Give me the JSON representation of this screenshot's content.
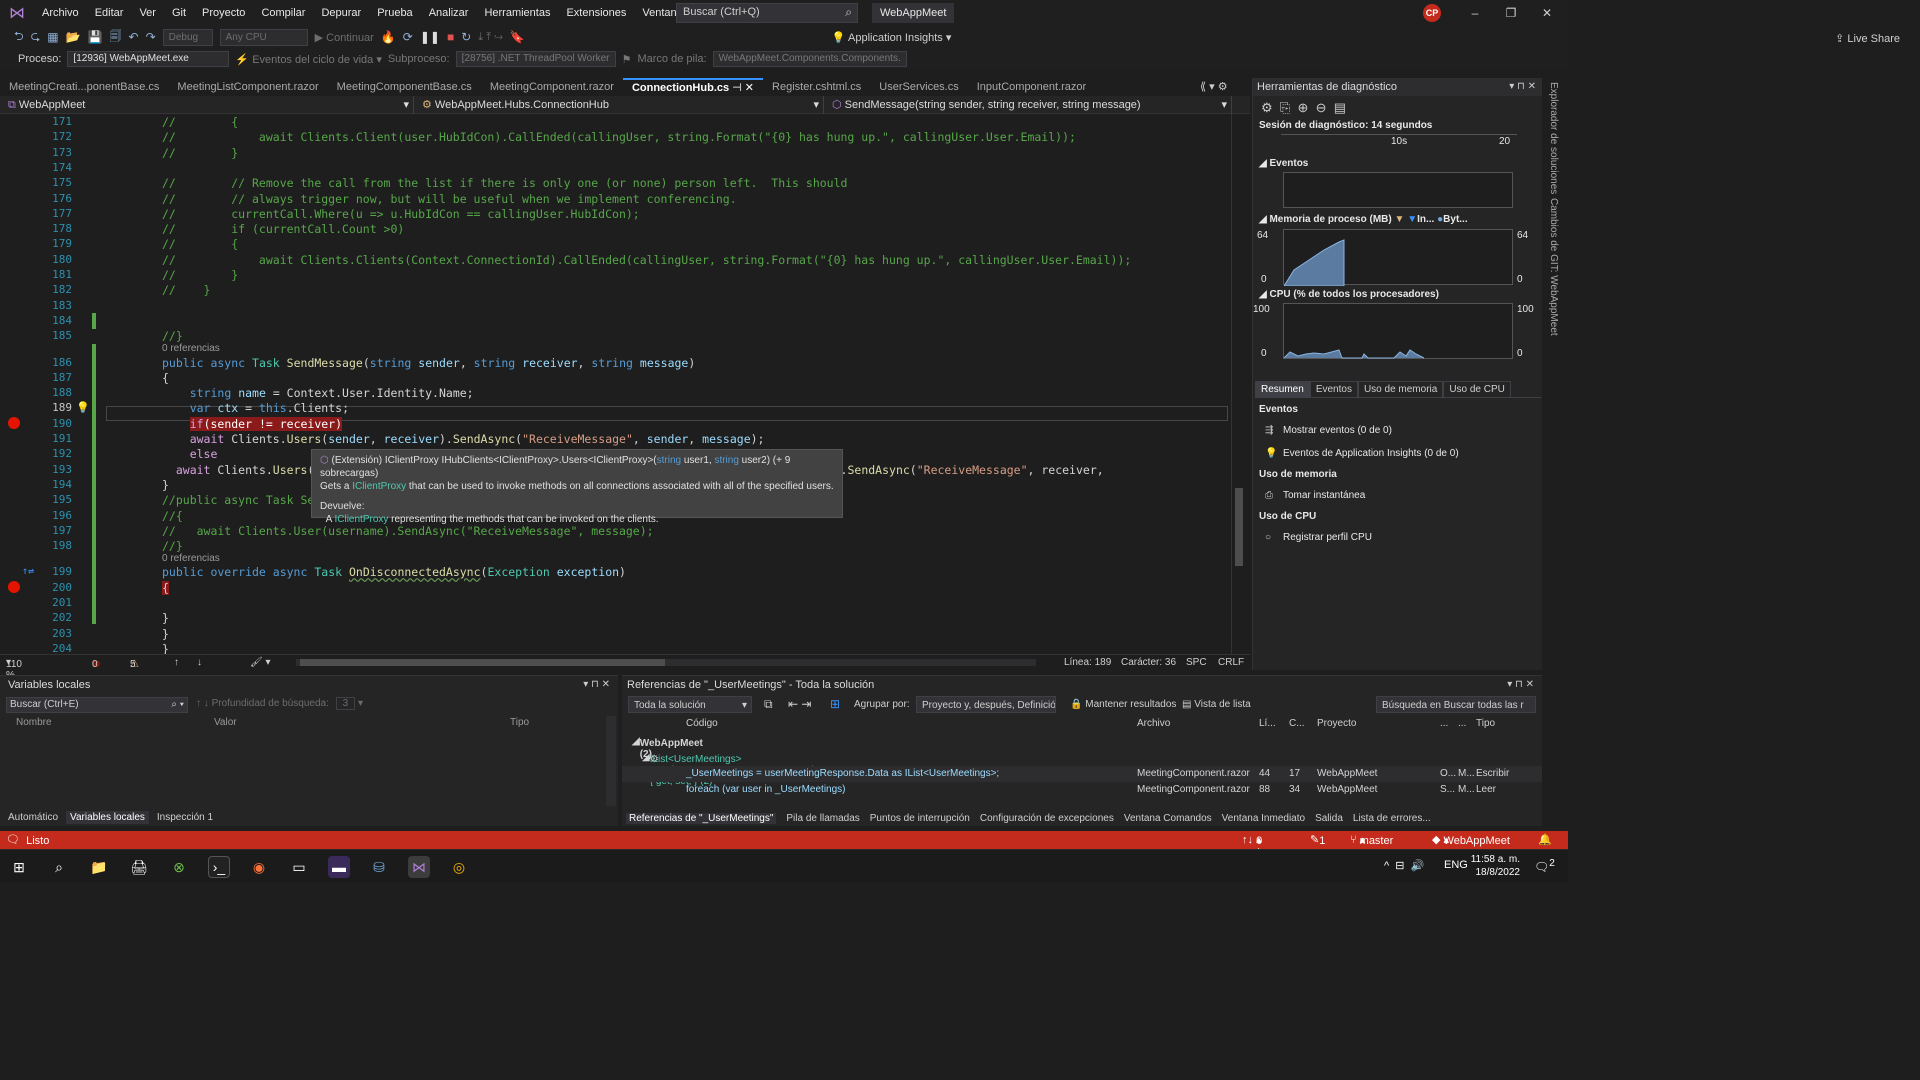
{
  "menu": [
    "Archivo",
    "Editar",
    "Ver",
    "Git",
    "Proyecto",
    "Compilar",
    "Depurar",
    "Prueba",
    "Analizar",
    "Herramientas",
    "Extensiones",
    "Ventana",
    "Ayuda"
  ],
  "search_placeholder": "Buscar (Ctrl+Q)",
  "solution_name": "WebAppMeet",
  "avatar": "CP",
  "toolbar": {
    "config": "Debug",
    "platform": "Any CPU",
    "continue": "Continuar",
    "app_insights": "Application Insights",
    "live_share": "Live Share"
  },
  "procbar": {
    "process_label": "Proceso:",
    "process_value": "[12936] WebAppMeet.exe",
    "lifecycle": "Eventos del ciclo de vida",
    "thread_label": "Subproceso:",
    "thread_value": "[28756] .NET ThreadPool Worker",
    "stack_label": "Marco de pila:",
    "stack_value": "WebAppMeet.Components.Components."
  },
  "tabs": [
    "MeetingCreati...ponentBase.cs",
    "MeetingListComponent.razor",
    "MeetingComponentBase.cs",
    "MeetingComponent.razor",
    "ConnectionHub.cs",
    "Register.cshtml.cs",
    "UserServices.cs",
    "InputComponent.razor"
  ],
  "active_tab_index": 4,
  "navbar": {
    "project": "WebAppMeet",
    "class": "WebAppMeet.Hubs.ConnectionHub",
    "member": "SendMessage(string sender, string receiver, string message)"
  },
  "code_lines": [
    {
      "n": "171",
      "html": "<span class='cm'>//        {</span>"
    },
    {
      "n": "172",
      "html": "<span class='cm'>//            await Clients.Client(user.HubIdCon).CallEnded(callingUser, string.Format(\"{0} has hung up.\", callingUser.User.Email));</span>"
    },
    {
      "n": "173",
      "html": "<span class='cm'>//        }</span>"
    },
    {
      "n": "174",
      "html": ""
    },
    {
      "n": "175",
      "html": "<span class='cm'>//        // Remove the call from the list if there is only one (or none) person left.  This should</span>"
    },
    {
      "n": "176",
      "html": "<span class='cm'>//        // always trigger now, but will be useful when we implement conferencing.</span>"
    },
    {
      "n": "177",
      "html": "<span class='cm'>//        currentCall.Where(u =&gt; u.HubIdCon == callingUser.HubIdCon);</span>"
    },
    {
      "n": "178",
      "html": "<span class='cm'>//        if (currentCall.Count &gt;0)</span>"
    },
    {
      "n": "179",
      "html": "<span class='cm'>//        {</span>"
    },
    {
      "n": "180",
      "html": "<span class='cm'>//            await Clients.Clients(Context.ConnectionId).CallEnded(callingUser, string.Format(\"{0} has hung up.\", callingUser.User.Email));</span>"
    },
    {
      "n": "181",
      "html": "<span class='cm'>//        }</span>"
    },
    {
      "n": "182",
      "html": "<span class='cm'>//    }</span>"
    },
    {
      "n": "183",
      "html": ""
    },
    {
      "n": "184",
      "html": ""
    },
    {
      "n": "185",
      "html": "<span class='cm'>//}</span>"
    },
    {
      "n": "186",
      "html": "<span class='kw'>public async</span> <span class='ty'>Task</span> <span class='fn'>SendMessage</span>(<span class='kw'>string</span> <span class='pm'>sender</span>, <span class='kw'>string</span> <span class='pm'>receiver</span>, <span class='kw'>string</span> <span class='pm'>message</span>)"
    },
    {
      "n": "187",
      "html": "{"
    },
    {
      "n": "188",
      "html": "    <span class='kw'>string</span> <span class='pm'>name</span> = Context.User.Identity.Name;"
    },
    {
      "n": "189",
      "html": "    <span class='kw'>var</span> <span class='pm'>ctx</span> = <span class='kw'>this</span>.Clients;"
    },
    {
      "n": "190",
      "html": "    <span style='background:#8b1a1a;color:#fff'><span class='kc'>if</span>(sender != receiver)</span>"
    },
    {
      "n": "191",
      "html": "    <span class='kc'>await</span> Clients.<span class='fn'>Users</span>(<span class='pm'>sender</span>, <span class='pm'>receiver</span>).<span class='fn'>SendAsync</span>(<span class='st'>\"ReceiveMessage\"</span>, <span class='pm'>sender</span>, <span class='pm'>message</span>);"
    },
    {
      "n": "192",
      "html": "    <span class='kc'>else</span>"
    },
    {
      "n": "193",
      "html": "  <span class='kc'>await</span> Clients.<span class='fn'>Users</span>(                                                           <span class='kc'>await</span> Clients.All.<span class='fn'>SendAsync</span>(<span class='st'>\"ReceiveMessage\"</span>, receiver,"
    },
    {
      "n": "194",
      "html": "}"
    },
    {
      "n": "195",
      "html": "<span class='cm'>//public async Task Se</span>"
    },
    {
      "n": "196",
      "html": "<span class='cm'>//{</span>"
    },
    {
      "n": "197",
      "html": "<span class='cm'>//   await Clients.User(username).SendAsync(\"ReceiveMessage\", message);</span>"
    },
    {
      "n": "198",
      "html": "<span class='cm'>//}</span>"
    },
    {
      "n": "199",
      "html": "<span class='kw'>public override async</span> <span class='ty'>Task</span> <span class='fn' style='text-decoration:underline wavy #6a9955'>OnDisconnectedAsync</span>(<span class='ty'>Exception</span> <span class='pm'>exception</span>)"
    },
    {
      "n": "200",
      "html": "<span style='background:#8b1a1a'>{</span>"
    },
    {
      "n": "201",
      "html": ""
    },
    {
      "n": "202",
      "html": "}"
    },
    {
      "n": "203",
      "html": "}"
    },
    {
      "n": "204",
      "html": "}"
    }
  ],
  "refs_labels": {
    "r186": "0 referencias",
    "r199": "0 referencias"
  },
  "tooltip": {
    "line1_a": "(Extensión) IClientProxy IHubClients<IClientProxy>.Users<IClientProxy>(",
    "line1_b": "string",
    "line1_c": " user1, ",
    "line1_d": "string",
    "line1_e": " user2) (+ 9 sobrecargas)",
    "line2_a": "Gets a ",
    "line2_b": "IClientProxy",
    "line2_c": " that can be used to invoke methods on all connections associated with all of the specified users.",
    "returns_label": "Devuelve:",
    "returns_a": "A ",
    "returns_b": "IClientProxy",
    "returns_c": " representing the methods that can be invoked on the clients."
  },
  "edstatus": {
    "zoom": "110 %",
    "errors": "0",
    "warnings": "5",
    "line": "Línea: 189",
    "col": "Carácter: 36",
    "spc": "SPC",
    "crlf": "CRLF"
  },
  "diag": {
    "title": "Herramientas de diagnóstico",
    "session": "Sesión de diagnóstico: 14 segundos",
    "t10": "10s",
    "t20": "20",
    "events": "Eventos",
    "mem_title": "Memoria de proceso (MB)",
    "mem_legend1": "In...",
    "mem_legend2": "Byt...",
    "mem_max": "64",
    "mem_min": "0",
    "cpu_title": "CPU (% de todos los procesadores)",
    "cpu_max": "100",
    "cpu_min": "0",
    "tabs": [
      "Resumen",
      "Eventos",
      "Uso de memoria",
      "Uso de CPU"
    ],
    "h_events": "Eventos",
    "show_events": "Mostrar eventos (0 de 0)",
    "ai_events": "Eventos de Application Insights (0 de 0)",
    "h_mem": "Uso de memoria",
    "snapshot": "Tomar instantánea",
    "h_cpu": "Uso de CPU",
    "cpu_profile": "Registrar perfil CPU"
  },
  "side_labels": [
    "Explorador de soluciones",
    "Cambios de GIT: WebAppMeet"
  ],
  "locals": {
    "title": "Variables locales",
    "search": "Buscar (Ctrl+E)",
    "depth": "Profundidad de búsqueda:",
    "depth_val": "3",
    "cols": [
      "Nombre",
      "Valor",
      "Tipo"
    ],
    "tabs": [
      "Automático",
      "Variables locales",
      "Inspección 1"
    ]
  },
  "refs": {
    "title": "Referencias de \"_UserMeetings\" - Toda la solución",
    "scope": "Toda la solución",
    "group_label": "Agrupar por:",
    "group_val": "Proyecto y, después, Definició",
    "keep": "Mantener resultados",
    "list": "Vista de lista",
    "search": "Búsqueda en Buscar todas las r",
    "cols": [
      "Código",
      "Archivo",
      "Lí...",
      "C...",
      "Proyecto",
      "...",
      "...",
      "Tipo"
    ],
    "group": "WebAppMeet (2)",
    "def": "IList<UserMeetings> MeetingComponentBase._UserMeetings { get; set; } (2)",
    "rows": [
      {
        "code": "_UserMeetings = userMeetingResponse.Data as IList<UserMeetings>;",
        "file": "MeetingComponent.razor",
        "line": "44",
        "col": "17",
        "proj": "WebAppMeet",
        "a": "O...",
        "b": "M...",
        "type": "Escribir"
      },
      {
        "code": "foreach (var user in _UserMeetings)",
        "file": "MeetingComponent.razor",
        "line": "88",
        "col": "34",
        "proj": "WebAppMeet",
        "a": "S...",
        "b": "M...",
        "type": "Leer"
      }
    ],
    "tabs": [
      "Referencias de \"_UserMeetings\"",
      "Pila de llamadas",
      "Puntos de interrupción",
      "Configuración de excepciones",
      "Ventana Comandos",
      "Ventana Inmediato",
      "Salida",
      "Lista de errores..."
    ]
  },
  "status": {
    "ready": "Listo",
    "sync": "0 / 0",
    "pencil": "1",
    "branch": "master",
    "repo": "WebAppMeet"
  },
  "taskbar": {
    "lang": "ENG",
    "time": "11:58 a. m.",
    "date": "18/8/2022",
    "notif": "2"
  },
  "colors": {
    "accent": "#3794ff",
    "statusbar": "#c42b1c",
    "breakpoint": "#e51400"
  }
}
